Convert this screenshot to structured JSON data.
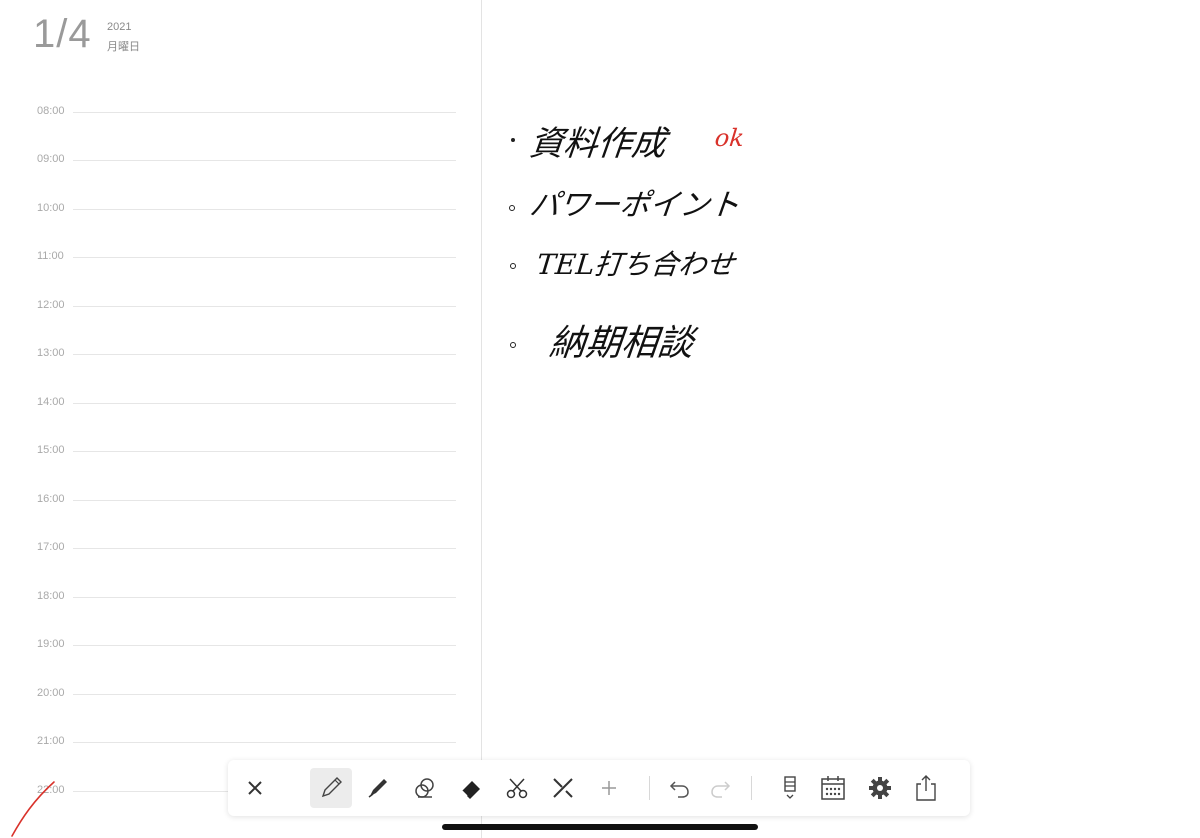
{
  "header": {
    "day": "1/4",
    "year": "2021",
    "weekday": "月曜日"
  },
  "schedule": {
    "hours": [
      "08:00",
      "09:00",
      "10:00",
      "11:00",
      "12:00",
      "13:00",
      "14:00",
      "15:00",
      "16:00",
      "17:00",
      "18:00",
      "19:00",
      "20:00",
      "21:00",
      "22:00"
    ]
  },
  "notes": {
    "items": [
      "資料作成",
      "パワーポイント",
      "TEL打ち合わせ",
      "納期相談"
    ],
    "annotation": "ok"
  },
  "toolbar": {
    "tools": [
      "close-icon",
      "pencil-icon",
      "marker-icon",
      "stamp-icon",
      "eraser-icon",
      "scissors-icon",
      "ruler-pen-icon",
      "plus-icon",
      "undo-icon",
      "redo-icon",
      "day-view-icon",
      "calendar-icon",
      "gear-icon",
      "share-icon"
    ],
    "active_tool": "pencil-icon"
  },
  "colors": {
    "accent_red": "#d9322b",
    "line": "#e6e6e6",
    "label": "#a9a9a9"
  }
}
